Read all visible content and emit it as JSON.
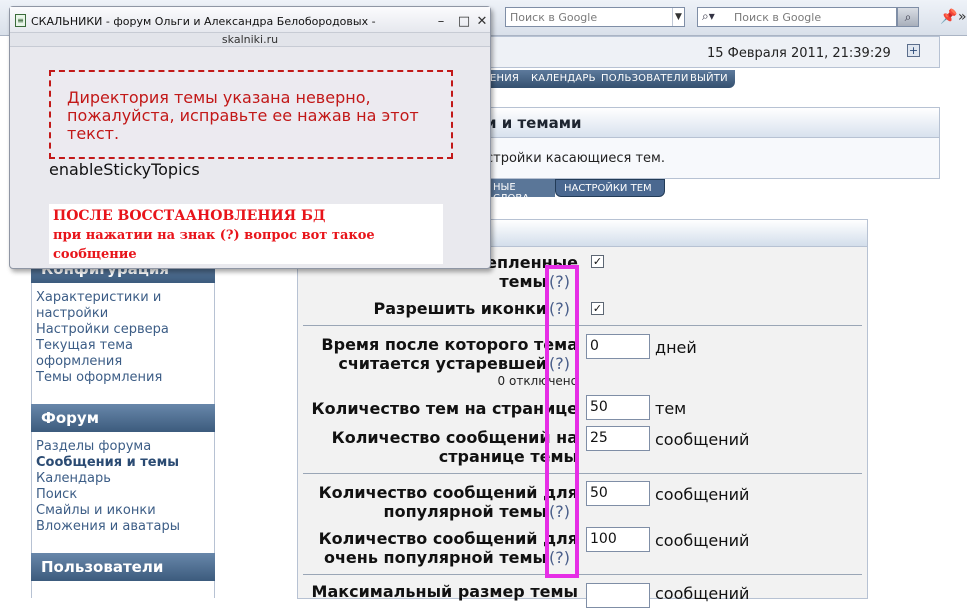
{
  "browser": {
    "search_placeholder_1": "Поиск в Google",
    "search_placeholder_2": "Поиск в Google"
  },
  "header": {
    "datetime": "15 Февраля 2011, 21:39:29",
    "menu": [
      "ЕНИЯ",
      "КАЛЕНДАРЬ",
      "ПОЛЬЗОВАТЕЛИ",
      "ВЫЙТИ"
    ]
  },
  "section": {
    "title": "и и темами",
    "description": "стройки касающиеся тем.",
    "subtabs": [
      "НЫЕ СЛОВА",
      "НАСТРОЙКИ ТЕМ"
    ]
  },
  "sidebar": {
    "config_head": "Конфигурация",
    "config_links": [
      "Характеристики и",
      "настройки",
      "Настройки сервера",
      "Текущая тема",
      "оформления",
      "Темы оформления"
    ],
    "forum_head": "Форум",
    "forum_links": [
      "Разделы форума",
      "Сообщения и темы",
      "Календарь",
      "Поиск",
      "Смайлы и иконки",
      "Вложения и аватары"
    ],
    "users_head": "Пользователи"
  },
  "settings": {
    "q": "(?)",
    "row1_l1": "епленные",
    "row1_l2": "темы",
    "row1_checked": "✓",
    "row2": "Разрешить иконки",
    "row2_checked": "✓",
    "row3_l1": "Время после которого тема",
    "row3_l2": "считается устаревшей",
    "row3_sub": "0 отключено",
    "row3_value": "0",
    "row3_unit": "дней",
    "row4": "Количество тем на странице",
    "row4_value": "50",
    "row4_unit": "тем",
    "row5_l1": "Количество сообщений на",
    "row5_l2": "странице темы",
    "row5_value": "25",
    "row5_unit": "сообщений",
    "row6_l1": "Количество сообщений для",
    "row6_l2": "популярной темы",
    "row6_value": "50",
    "row6_unit": "сообщений",
    "row7_l1": "Количество сообщений для",
    "row7_l2": "очень популярной темы",
    "row7_value": "100",
    "row7_unit": "сообщений",
    "row8_partial": "Максимальный размер темы",
    "row8_unit": "сообщений"
  },
  "popup": {
    "title": "СКАЛЬНИКИ - форум Ольги и Александра Белобородовых -",
    "url": "skalniki.ru",
    "error_text": "Директория темы указана неверно, пожалуйста, исправьте ее нажав на этот текст.",
    "param": "enableStickyTopics",
    "note_line1": "ПОСЛЕ ВОССТААНОВЛЕНИЯ БД",
    "note_line2": "при нажатии на знак (?) вопрос вот такое сообщение"
  },
  "colors": {
    "highlight": "#e62ee6",
    "error": "#c21818",
    "note": "#e8141a"
  }
}
